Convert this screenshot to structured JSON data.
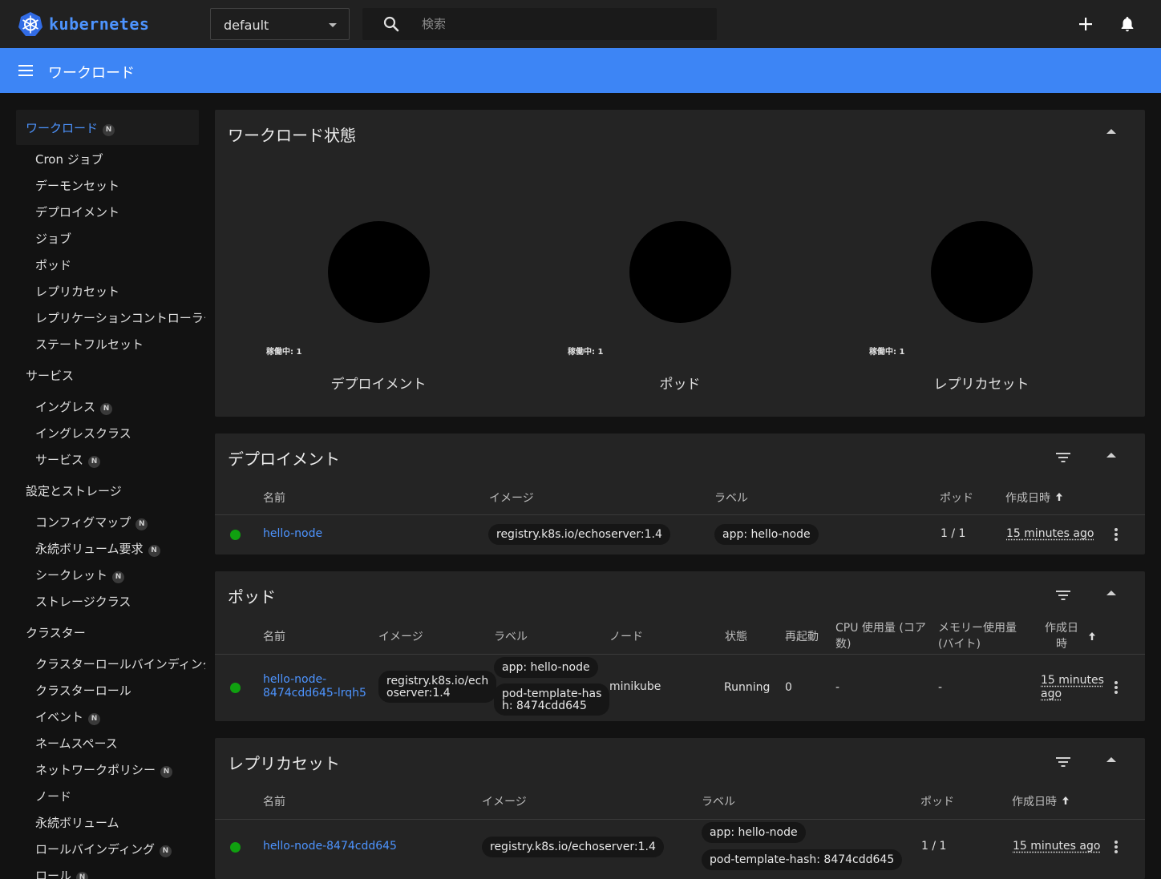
{
  "header": {
    "logo_text": "kubernetes",
    "namespace": "default",
    "search_placeholder": "検索"
  },
  "bluebar": {
    "title": "ワークロード"
  },
  "sidebar": {
    "workloads": {
      "label": "ワークロード",
      "badge": "N"
    },
    "workload_items": [
      {
        "label": "Cron ジョブ"
      },
      {
        "label": "デーモンセット"
      },
      {
        "label": "デプロイメント"
      },
      {
        "label": "ジョブ"
      },
      {
        "label": "ポッド"
      },
      {
        "label": "レプリカセット"
      },
      {
        "label": "レプリケーションコントローラー"
      },
      {
        "label": "ステートフルセット"
      }
    ],
    "services": {
      "label": "サービス"
    },
    "service_items": [
      {
        "label": "イングレス",
        "badge": "N"
      },
      {
        "label": "イングレスクラス"
      },
      {
        "label": "サービス",
        "badge": "N"
      }
    ],
    "config": {
      "label": "設定とストレージ"
    },
    "config_items": [
      {
        "label": "コンフィグマップ",
        "badge": "N"
      },
      {
        "label": "永続ボリューム要求",
        "badge": "N"
      },
      {
        "label": "シークレット",
        "badge": "N"
      },
      {
        "label": "ストレージクラス"
      }
    ],
    "cluster": {
      "label": "クラスター"
    },
    "cluster_items": [
      {
        "label": "クラスターロールバインディング"
      },
      {
        "label": "クラスターロール"
      },
      {
        "label": "イベント",
        "badge": "N"
      },
      {
        "label": "ネームスペース"
      },
      {
        "label": "ネットワークポリシー",
        "badge": "N"
      },
      {
        "label": "ノード"
      },
      {
        "label": "永続ボリューム"
      },
      {
        "label": "ロールバインディング",
        "badge": "N"
      },
      {
        "label": "ロール",
        "badge": "N"
      }
    ]
  },
  "status_card": {
    "title": "ワークロード状態",
    "charts": [
      {
        "legend": "稼働中: 1",
        "label": "デプロイメント"
      },
      {
        "legend": "稼働中: 1",
        "label": "ポッド"
      },
      {
        "legend": "稼働中: 1",
        "label": "レプリカセット"
      }
    ]
  },
  "deployments": {
    "title": "デプロイメント",
    "columns": {
      "name": "名前",
      "image": "イメージ",
      "labels": "ラベル",
      "pods": "ポッド",
      "created": "作成日時"
    },
    "rows": [
      {
        "name": "hello-node",
        "image": "registry.k8s.io/echoserver:1.4",
        "label": "app: hello-node",
        "pods": "1 / 1",
        "created": "15 minutes ago"
      }
    ]
  },
  "pods": {
    "title": "ポッド",
    "columns": {
      "name": "名前",
      "image": "イメージ",
      "labels": "ラベル",
      "node": "ノード",
      "status": "状態",
      "restarts": "再起動",
      "cpu_1": "CPU 使用量 (コア",
      "cpu_2": "数)",
      "mem_1": "メモリー使用量",
      "mem_2": "(バイト)",
      "created_1": "作成日",
      "created_2": "時"
    },
    "rows": [
      {
        "name_1": "hello-node-",
        "name_2": "8474cdd645-lrqh5",
        "image_1": "registry.k8s.io/ech",
        "image_2": "oserver:1.4",
        "label_1": "app: hello-node",
        "label_2a": "pod-template-has",
        "label_2b": "h: 8474cdd645",
        "node": "minikube",
        "status": "Running",
        "restarts": "0",
        "cpu": "-",
        "mem": "-",
        "created_1": "15 minutes",
        "created_2": "ago"
      }
    ]
  },
  "replicasets": {
    "title": "レプリカセット",
    "columns": {
      "name": "名前",
      "image": "イメージ",
      "labels": "ラベル",
      "pods": "ポッド",
      "created": "作成日時"
    },
    "rows": [
      {
        "name": "hello-node-8474cdd645",
        "image": "registry.k8s.io/echoserver:1.4",
        "label_1": "app: hello-node",
        "label_2": "pod-template-hash: 8474cdd645",
        "pods": "1 / 1",
        "created": "15 minutes ago"
      }
    ]
  }
}
